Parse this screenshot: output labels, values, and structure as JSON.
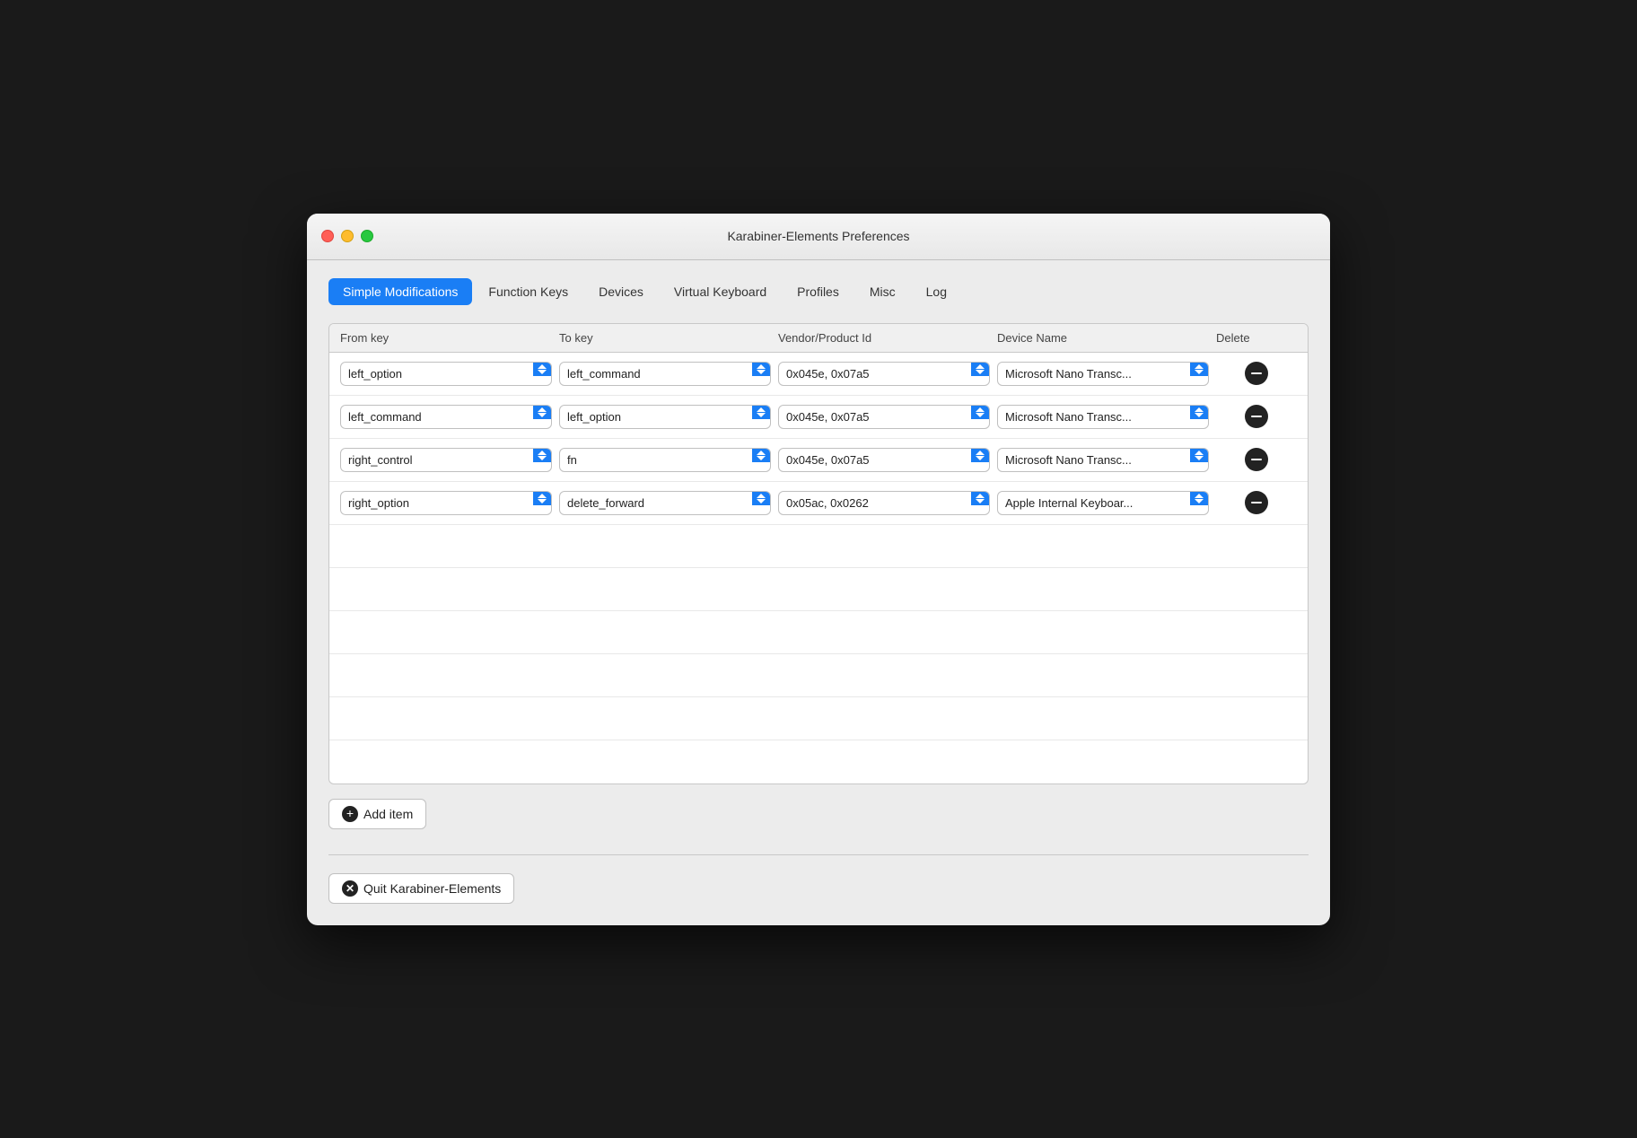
{
  "window": {
    "title": "Karabiner-Elements Preferences"
  },
  "tabs": [
    {
      "id": "simple-modifications",
      "label": "Simple Modifications",
      "active": true
    },
    {
      "id": "function-keys",
      "label": "Function Keys",
      "active": false
    },
    {
      "id": "devices",
      "label": "Devices",
      "active": false
    },
    {
      "id": "virtual-keyboard",
      "label": "Virtual Keyboard",
      "active": false
    },
    {
      "id": "profiles",
      "label": "Profiles",
      "active": false
    },
    {
      "id": "misc",
      "label": "Misc",
      "active": false
    },
    {
      "id": "log",
      "label": "Log",
      "active": false
    }
  ],
  "table": {
    "headers": {
      "from_key": "From key",
      "to_key": "To key",
      "vendor_product_id": "Vendor/Product Id",
      "device_name": "Device Name",
      "delete": "Delete"
    },
    "rows": [
      {
        "from_key": "left_option",
        "to_key": "left_command",
        "vendor_product_id": "0x045e, 0x07a5",
        "device_name": "Microsoft Nano Transc..."
      },
      {
        "from_key": "left_command",
        "to_key": "left_option",
        "vendor_product_id": "0x045e, 0x07a5",
        "device_name": "Microsoft Nano Transc..."
      },
      {
        "from_key": "right_control",
        "to_key": "fn",
        "vendor_product_id": "0x045e, 0x07a5",
        "device_name": "Microsoft Nano Transc..."
      },
      {
        "from_key": "right_option",
        "to_key": "delete_forward",
        "vendor_product_id": "0x05ac, 0x0262",
        "device_name": "Apple Internal Keyboar..."
      }
    ],
    "empty_rows": 6
  },
  "buttons": {
    "add_item": "Add item",
    "quit": "Quit Karabiner-Elements"
  }
}
